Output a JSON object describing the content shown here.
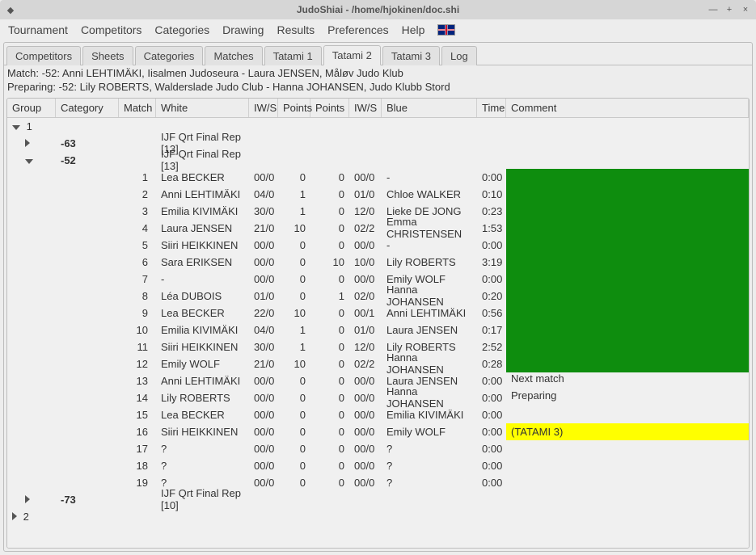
{
  "window": {
    "title": "JudoShiai - /home/hjokinen/doc.shi"
  },
  "menu": {
    "items": [
      "Tournament",
      "Competitors",
      "Categories",
      "Drawing",
      "Results",
      "Preferences",
      "Help"
    ]
  },
  "tabs": {
    "items": [
      "Competitors",
      "Sheets",
      "Categories",
      "Matches",
      "Tatami 1",
      "Tatami 2",
      "Tatami 3",
      "Log"
    ],
    "active": 5
  },
  "status": {
    "line1": "Match: -52: Anni LEHTIMÄKI, Iisalmen Judoseura - Laura JENSEN, Måløv Judo Klub",
    "line2": "Preparing: -52: Lily ROBERTS, Walderslade Judo Club - Hanna JOHANSEN, Judo Klubb Stord"
  },
  "columns": [
    "Group",
    "Category",
    "Match",
    "White",
    "IW/S",
    "Points",
    "Points",
    "IW/S",
    "Blue",
    "Time",
    "Comment"
  ],
  "groups": {
    "g1_label": "1",
    "g2_label": "2",
    "cat63": {
      "label": "-63",
      "draw": "IJF Qrt Final Rep [13]"
    },
    "cat52": {
      "label": "-52",
      "draw": "IJF Qrt Final Rep [13]"
    },
    "cat73": {
      "label": "-73",
      "draw": "IJF Qrt Final Rep [10]"
    }
  },
  "matches52": [
    {
      "n": "1",
      "white": "Lea BECKER",
      "iws1": "00/0",
      "p1": "0",
      "p2": "0",
      "iws2": "00/0",
      "blue": "-",
      "time": "0:00",
      "comment_type": "green",
      "comment": ""
    },
    {
      "n": "2",
      "white": "Anni LEHTIMÄKI",
      "iws1": "04/0",
      "p1": "1",
      "p2": "0",
      "iws2": "01/0",
      "blue": "Chloe WALKER",
      "time": "0:10",
      "comment_type": "green",
      "comment": ""
    },
    {
      "n": "3",
      "white": "Emilia KIVIMÄKI",
      "iws1": "30/0",
      "p1": "1",
      "p2": "0",
      "iws2": "12/0",
      "blue": "Lieke DE JONG",
      "time": "0:23",
      "comment_type": "green",
      "comment": ""
    },
    {
      "n": "4",
      "white": "Laura JENSEN",
      "iws1": "21/0",
      "p1": "10",
      "p2": "0",
      "iws2": "02/2",
      "blue": "Emma CHRISTENSEN",
      "time": "1:53",
      "comment_type": "green",
      "comment": ""
    },
    {
      "n": "5",
      "white": "Siiri HEIKKINEN",
      "iws1": "00/0",
      "p1": "0",
      "p2": "0",
      "iws2": "00/0",
      "blue": "-",
      "time": "0:00",
      "comment_type": "green",
      "comment": ""
    },
    {
      "n": "6",
      "white": "Sara ERIKSEN",
      "iws1": "00/0",
      "p1": "0",
      "p2": "10",
      "iws2": "10/0",
      "blue": "Lily ROBERTS",
      "time": "3:19",
      "comment_type": "green",
      "comment": ""
    },
    {
      "n": "7",
      "white": "-",
      "iws1": "00/0",
      "p1": "0",
      "p2": "0",
      "iws2": "00/0",
      "blue": "Emily WOLF",
      "time": "0:00",
      "comment_type": "green",
      "comment": ""
    },
    {
      "n": "8",
      "white": "Léa DUBOIS",
      "iws1": "01/0",
      "p1": "0",
      "p2": "1",
      "iws2": "02/0",
      "blue": "Hanna JOHANSEN",
      "time": "0:20",
      "comment_type": "green",
      "comment": ""
    },
    {
      "n": "9",
      "white": "Lea BECKER",
      "iws1": "22/0",
      "p1": "10",
      "p2": "0",
      "iws2": "00/1",
      "blue": "Anni LEHTIMÄKI",
      "time": "0:56",
      "comment_type": "green",
      "comment": ""
    },
    {
      "n": "10",
      "white": "Emilia KIVIMÄKI",
      "iws1": "04/0",
      "p1": "1",
      "p2": "0",
      "iws2": "01/0",
      "blue": "Laura JENSEN",
      "time": "0:17",
      "comment_type": "green",
      "comment": ""
    },
    {
      "n": "11",
      "white": "Siiri HEIKKINEN",
      "iws1": "30/0",
      "p1": "1",
      "p2": "0",
      "iws2": "12/0",
      "blue": "Lily ROBERTS",
      "time": "2:52",
      "comment_type": "green",
      "comment": ""
    },
    {
      "n": "12",
      "white": "Emily WOLF",
      "iws1": "21/0",
      "p1": "10",
      "p2": "0",
      "iws2": "02/2",
      "blue": "Hanna JOHANSEN",
      "time": "0:28",
      "comment_type": "green",
      "comment": ""
    },
    {
      "n": "13",
      "white": "Anni LEHTIMÄKI",
      "iws1": "00/0",
      "p1": "0",
      "p2": "0",
      "iws2": "00/0",
      "blue": "Laura JENSEN",
      "time": "0:00",
      "comment_type": "text",
      "comment": "Next match"
    },
    {
      "n": "14",
      "white": "Lily ROBERTS",
      "iws1": "00/0",
      "p1": "0",
      "p2": "0",
      "iws2": "00/0",
      "blue": "Hanna JOHANSEN",
      "time": "0:00",
      "comment_type": "text",
      "comment": "Preparing"
    },
    {
      "n": "15",
      "white": "Lea BECKER",
      "iws1": "00/0",
      "p1": "0",
      "p2": "0",
      "iws2": "00/0",
      "blue": "Emilia KIVIMÄKI",
      "time": "0:00",
      "comment_type": "none",
      "comment": ""
    },
    {
      "n": "16",
      "white": "Siiri HEIKKINEN",
      "iws1": "00/0",
      "p1": "0",
      "p2": "0",
      "iws2": "00/0",
      "blue": "Emily WOLF",
      "time": "0:00",
      "comment_type": "yellow",
      "comment": "(TATAMI 3)"
    },
    {
      "n": "17",
      "white": "?",
      "iws1": "00/0",
      "p1": "0",
      "p2": "0",
      "iws2": "00/0",
      "blue": "?",
      "time": "0:00",
      "comment_type": "none",
      "comment": ""
    },
    {
      "n": "18",
      "white": "?",
      "iws1": "00/0",
      "p1": "0",
      "p2": "0",
      "iws2": "00/0",
      "blue": "?",
      "time": "0:00",
      "comment_type": "none",
      "comment": ""
    },
    {
      "n": "19",
      "white": "?",
      "iws1": "00/0",
      "p1": "0",
      "p2": "0",
      "iws2": "00/0",
      "blue": "?",
      "time": "0:00",
      "comment_type": "none",
      "comment": ""
    }
  ]
}
